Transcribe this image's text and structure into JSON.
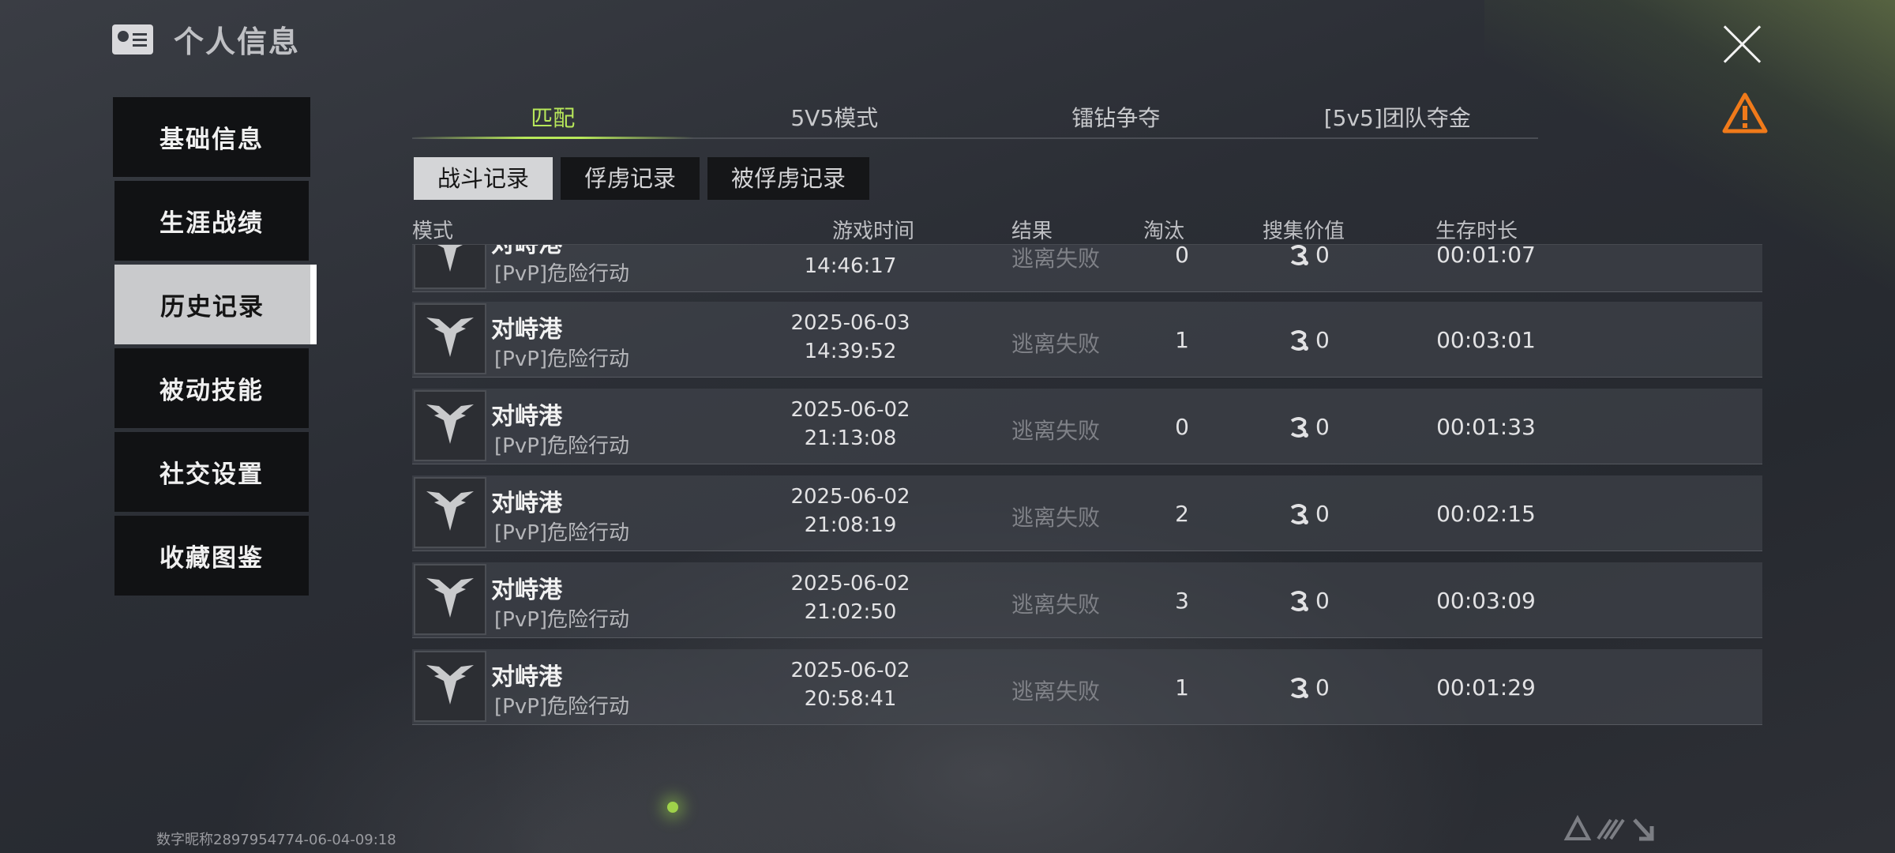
{
  "header": {
    "title": "个人信息",
    "icon": "id-card-icon"
  },
  "sidenav": {
    "items": [
      {
        "label": "基础信息",
        "active": false
      },
      {
        "label": "生涯战绩",
        "active": false
      },
      {
        "label": "历史记录",
        "active": true
      },
      {
        "label": "被动技能",
        "active": false
      },
      {
        "label": "社交设置",
        "active": false
      },
      {
        "label": "收藏图鉴",
        "active": false
      }
    ]
  },
  "tabs": [
    {
      "label": "匹配",
      "active": true
    },
    {
      "label": "5V5模式",
      "active": false
    },
    {
      "label": "镭钻争夺",
      "active": false
    },
    {
      "label": "[5v5]团队夺金",
      "active": false
    }
  ],
  "subtabs": [
    {
      "label": "战斗记录",
      "active": true
    },
    {
      "label": "俘虏记录",
      "active": false
    },
    {
      "label": "被俘虏记录",
      "active": false
    }
  ],
  "table": {
    "headers": {
      "mode": "模式",
      "time": "游戏时间",
      "result": "结果",
      "elim": "淘汰",
      "value": "搜集价值",
      "duration": "生存时长"
    },
    "rows": [
      {
        "name": "对峙港",
        "mode": "[PvP]危险行动",
        "date": "",
        "time": "14:46:17",
        "result": "逃离失败",
        "elim": "0",
        "value": "0",
        "duration": "00:01:07",
        "partial": true
      },
      {
        "name": "对峙港",
        "mode": "[PvP]危险行动",
        "date": "2025-06-03",
        "time": "14:39:52",
        "result": "逃离失败",
        "elim": "1",
        "value": "0",
        "duration": "00:03:01"
      },
      {
        "name": "对峙港",
        "mode": "[PvP]危险行动",
        "date": "2025-06-02",
        "time": "21:13:08",
        "result": "逃离失败",
        "elim": "0",
        "value": "0",
        "duration": "00:01:33"
      },
      {
        "name": "对峙港",
        "mode": "[PvP]危险行动",
        "date": "2025-06-02",
        "time": "21:08:19",
        "result": "逃离失败",
        "elim": "2",
        "value": "0",
        "duration": "00:02:15"
      },
      {
        "name": "对峙港",
        "mode": "[PvP]危险行动",
        "date": "2025-06-02",
        "time": "21:02:50",
        "result": "逃离失败",
        "elim": "3",
        "value": "0",
        "duration": "00:03:09"
      },
      {
        "name": "对峙港",
        "mode": "[PvP]危险行动",
        "date": "2025-06-02",
        "time": "20:58:41",
        "result": "逃离失败",
        "elim": "1",
        "value": "0",
        "duration": "00:01:29"
      }
    ]
  },
  "footer": {
    "id_text": "数字昵称2897954774-06-04-09:18"
  },
  "colors": {
    "accent": "#b8e85a",
    "warning": "#f07a1a"
  }
}
